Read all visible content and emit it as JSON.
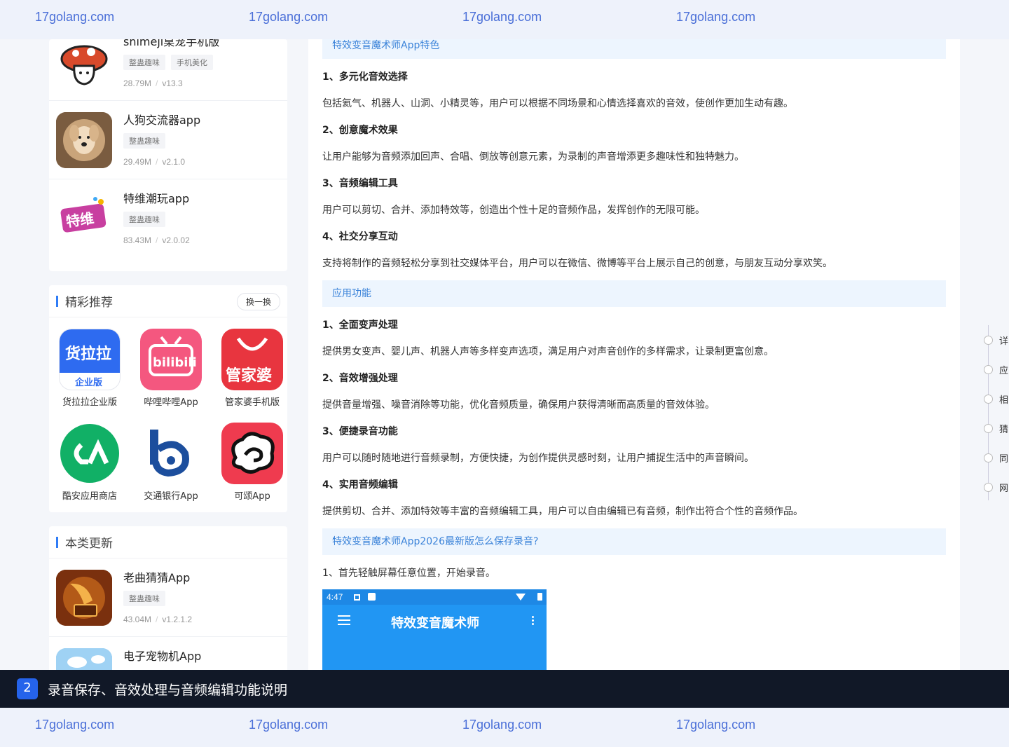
{
  "watermark": {
    "text": "17golang.com"
  },
  "sidebar": {
    "top_apps": [
      {
        "name": "shimeji桌宠手机版",
        "tags": [
          "整蛊趣味",
          "手机美化"
        ],
        "size": "28.79M",
        "version": "v13.3"
      },
      {
        "name": "人狗交流器app",
        "tags": [
          "整蛊趣味"
        ],
        "size": "29.49M",
        "version": "v2.1.0"
      },
      {
        "name": "特维潮玩app",
        "tags": [
          "整蛊趣味"
        ],
        "size": "83.43M",
        "version": "v2.0.02"
      }
    ],
    "recommend": {
      "title": "精彩推荐",
      "swap_label": "换一换",
      "apps": [
        {
          "name": "货拉拉企业版"
        },
        {
          "name": "哔哩哔哩App"
        },
        {
          "name": "管家婆手机版"
        },
        {
          "name": "酷安应用商店"
        },
        {
          "name": "交通银行App"
        },
        {
          "name": "可颂App"
        }
      ]
    },
    "updates": {
      "title": "本类更新",
      "apps": [
        {
          "name": "老曲猜猜App",
          "tags": [
            "整蛊趣味"
          ],
          "size": "43.04M",
          "version": "v1.2.1.2"
        },
        {
          "name": "电子宠物机App"
        }
      ]
    }
  },
  "article": {
    "section1_title": "特效变音魔术师App特色",
    "section1_items": [
      {
        "title": "1、多元化音效选择",
        "text": "包括氦气、机器人、山洞、小精灵等，用户可以根据不同场景和心情选择喜欢的音效，使创作更加生动有趣。"
      },
      {
        "title": "2、创意魔术效果",
        "text": "让用户能够为音频添加回声、合唱、倒放等创意元素，为录制的声音增添更多趣味性和独特魅力。"
      },
      {
        "title": "3、音频编辑工具",
        "text": "用户可以剪切、合并、添加特效等，创造出个性十足的音频作品，发挥创作的无限可能。"
      },
      {
        "title": "4、社交分享互动",
        "text": "支持将制作的音频轻松分享到社交媒体平台，用户可以在微信、微博等平台上展示自己的创意，与朋友互动分享欢笑。"
      }
    ],
    "section2_title": "应用功能",
    "section2_items": [
      {
        "title": "1、全面变声处理",
        "text": "提供男女变声、婴儿声、机器人声等多样变声选项，满足用户对声音创作的多样需求，让录制更富创意。"
      },
      {
        "title": "2、音效增强处理",
        "text": "提供音量增强、噪音消除等功能，优化音频质量，确保用户获得清晰而高质量的音效体验。"
      },
      {
        "title": "3、便捷录音功能",
        "text": "用户可以随时随地进行音频录制，方便快捷，为创作提供灵感时刻，让用户捕捉生活中的声音瞬间。"
      },
      {
        "title": "4、实用音频编辑",
        "text": "提供剪切、合并、添加特效等丰富的音频编辑工具，用户可以自由编辑已有音频，制作出符合个性的音频作品。"
      }
    ],
    "section3_title": "特效变音魔术师App2026最新版怎么保存录音?",
    "step1": "1、首先轻触屏幕任意位置，开始录音。",
    "screenshot": {
      "time": "4:47",
      "title": "特效变音魔术师"
    }
  },
  "toc": {
    "items": [
      "详",
      "应",
      "相",
      "猜",
      "同",
      "网"
    ]
  },
  "caption": {
    "number": "2",
    "text": "录音保存、音效处理与音频编辑功能说明"
  }
}
